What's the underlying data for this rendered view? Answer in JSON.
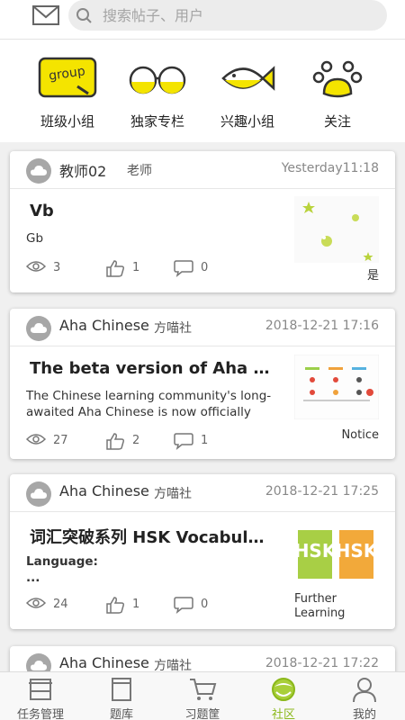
{
  "header": {
    "mail_icon": "mail-icon",
    "search_placeholder": "搜索帖子、用户"
  },
  "categories": [
    {
      "label": "班级小组",
      "icon": "group-icon"
    },
    {
      "label": "独家专栏",
      "icon": "glasses-icon"
    },
    {
      "label": "兴趣小组",
      "icon": "fish-icon"
    },
    {
      "label": "关注",
      "icon": "paw-icon"
    }
  ],
  "posts": [
    {
      "author": "教师02",
      "role": "老师",
      "date": "Yesterday11:18",
      "title": "Vb",
      "body": "Gb",
      "views": "3",
      "likes": "1",
      "comments": "0",
      "tag": "是"
    },
    {
      "author": "Aha Chinese",
      "role": "方喵社",
      "date": "2018-12-21 17:16",
      "title": "The beta version of Aha Chinese",
      "body": "The Chinese learning community's long-awaited Aha Chinese is now officially online",
      "views": "27",
      "likes": "2",
      "comments": "1",
      "tag": "Notice"
    },
    {
      "author": "Aha Chinese",
      "role": "方喵社",
      "date": "2018-12-21 17:25",
      "title": "词汇突破系列 HSK Vocabulary",
      "body_line1": "Language:",
      "body_line2": "...",
      "views": "24",
      "likes": "1",
      "comments": "0",
      "tag": "Further Learning"
    },
    {
      "author": "Aha Chinese",
      "role": "方喵社",
      "date": "2018-12-21 17:22"
    }
  ],
  "tabs": [
    {
      "label": "任务管理",
      "icon": "tasks-icon"
    },
    {
      "label": "题库",
      "icon": "question-bank-icon"
    },
    {
      "label": "习题筐",
      "icon": "cart-icon"
    },
    {
      "label": "社区",
      "icon": "community-icon",
      "active": true
    },
    {
      "label": "我的",
      "icon": "person-icon"
    }
  ],
  "colors": {
    "accent": "#8bb81a",
    "yellow": "#f2e100"
  }
}
